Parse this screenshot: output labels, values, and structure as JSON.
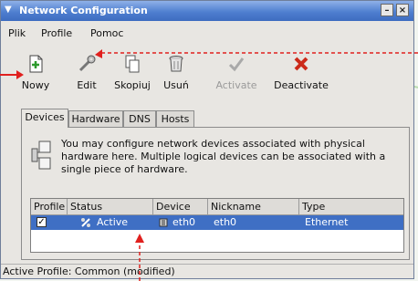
{
  "window": {
    "title": "Network Configuration",
    "minimize_label": "–",
    "close_label": "×"
  },
  "menu": {
    "items": [
      "Plik",
      "Profile",
      "Pomoc"
    ]
  },
  "toolbar": {
    "buttons": [
      {
        "label": "Nowy",
        "icon": "new-icon"
      },
      {
        "label": "Edit",
        "icon": "edit-icon"
      },
      {
        "label": "Skopiuj",
        "icon": "copy-icon"
      },
      {
        "label": "Usuń",
        "icon": "delete-icon"
      },
      {
        "label": "Activate",
        "icon": "activate-icon",
        "disabled": true
      },
      {
        "label": "Deactivate",
        "icon": "deactivate-icon"
      }
    ]
  },
  "tabs": [
    "Devices",
    "Hardware",
    "DNS",
    "Hosts"
  ],
  "info_text": "You may configure network devices associated with physical hardware here.  Multiple logical devices can be associated with a single piece of hardware.",
  "table": {
    "headers": [
      "Profile",
      "Status",
      "Device",
      "Nickname",
      "Type"
    ],
    "rows": [
      {
        "profile_checked": true,
        "status": "Active",
        "device": "eth0",
        "nickname": "eth0",
        "type": "Ethernet"
      }
    ]
  },
  "statusbar": {
    "text": "Active Profile: Common (modified)"
  },
  "colors": {
    "titlebar": "#4f7fd0",
    "selection": "#3f6fc4",
    "annotation": "#e0201e"
  }
}
